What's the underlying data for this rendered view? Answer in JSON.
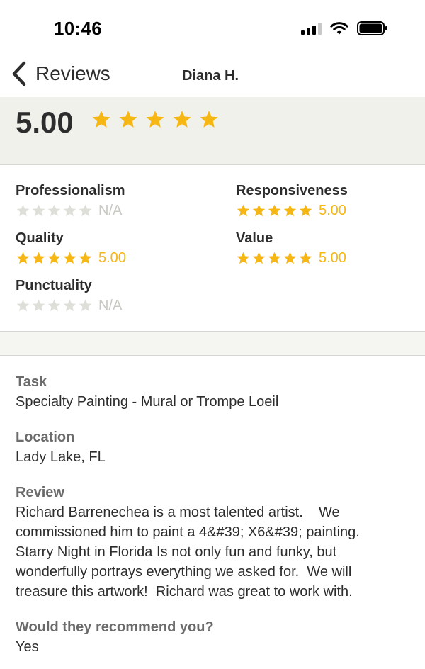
{
  "status_bar": {
    "time": "10:46",
    "icons": [
      "signal-icon",
      "wifi-icon",
      "battery-icon"
    ]
  },
  "nav": {
    "back_label": "Reviews",
    "reviewer_name": "Diana H."
  },
  "overall": {
    "score": "5.00",
    "stars": 5
  },
  "colors": {
    "star_on": "#f6b614",
    "star_off": "#dedfd9"
  },
  "categories": [
    {
      "label": "Professionalism",
      "value": "N/A",
      "stars": 0
    },
    {
      "label": "Responsiveness",
      "value": "5.00",
      "stars": 5
    },
    {
      "label": "Quality",
      "value": "5.00",
      "stars": 5
    },
    {
      "label": "Value",
      "value": "5.00",
      "stars": 5
    },
    {
      "label": "Punctuality",
      "value": "N/A",
      "stars": 0
    }
  ],
  "details": {
    "task_label": "Task",
    "task_value": "Specialty Painting - Mural or Trompe Loeil",
    "location_label": "Location",
    "location_value": "Lady Lake, FL",
    "review_label": "Review",
    "review_lines": [
      "Richard Barrenechea is a most talented artist.    We",
      "commissioned him to paint a 4&#39; X6&#39; painting.",
      "Starry Night in Florida Is not only fun and funky, but",
      "wonderfully portrays everything we asked for.  We will",
      "treasure this artwork!  Richard was great to work with."
    ],
    "recommend_label": "Would they recommend you?",
    "recommend_value": "Yes"
  }
}
